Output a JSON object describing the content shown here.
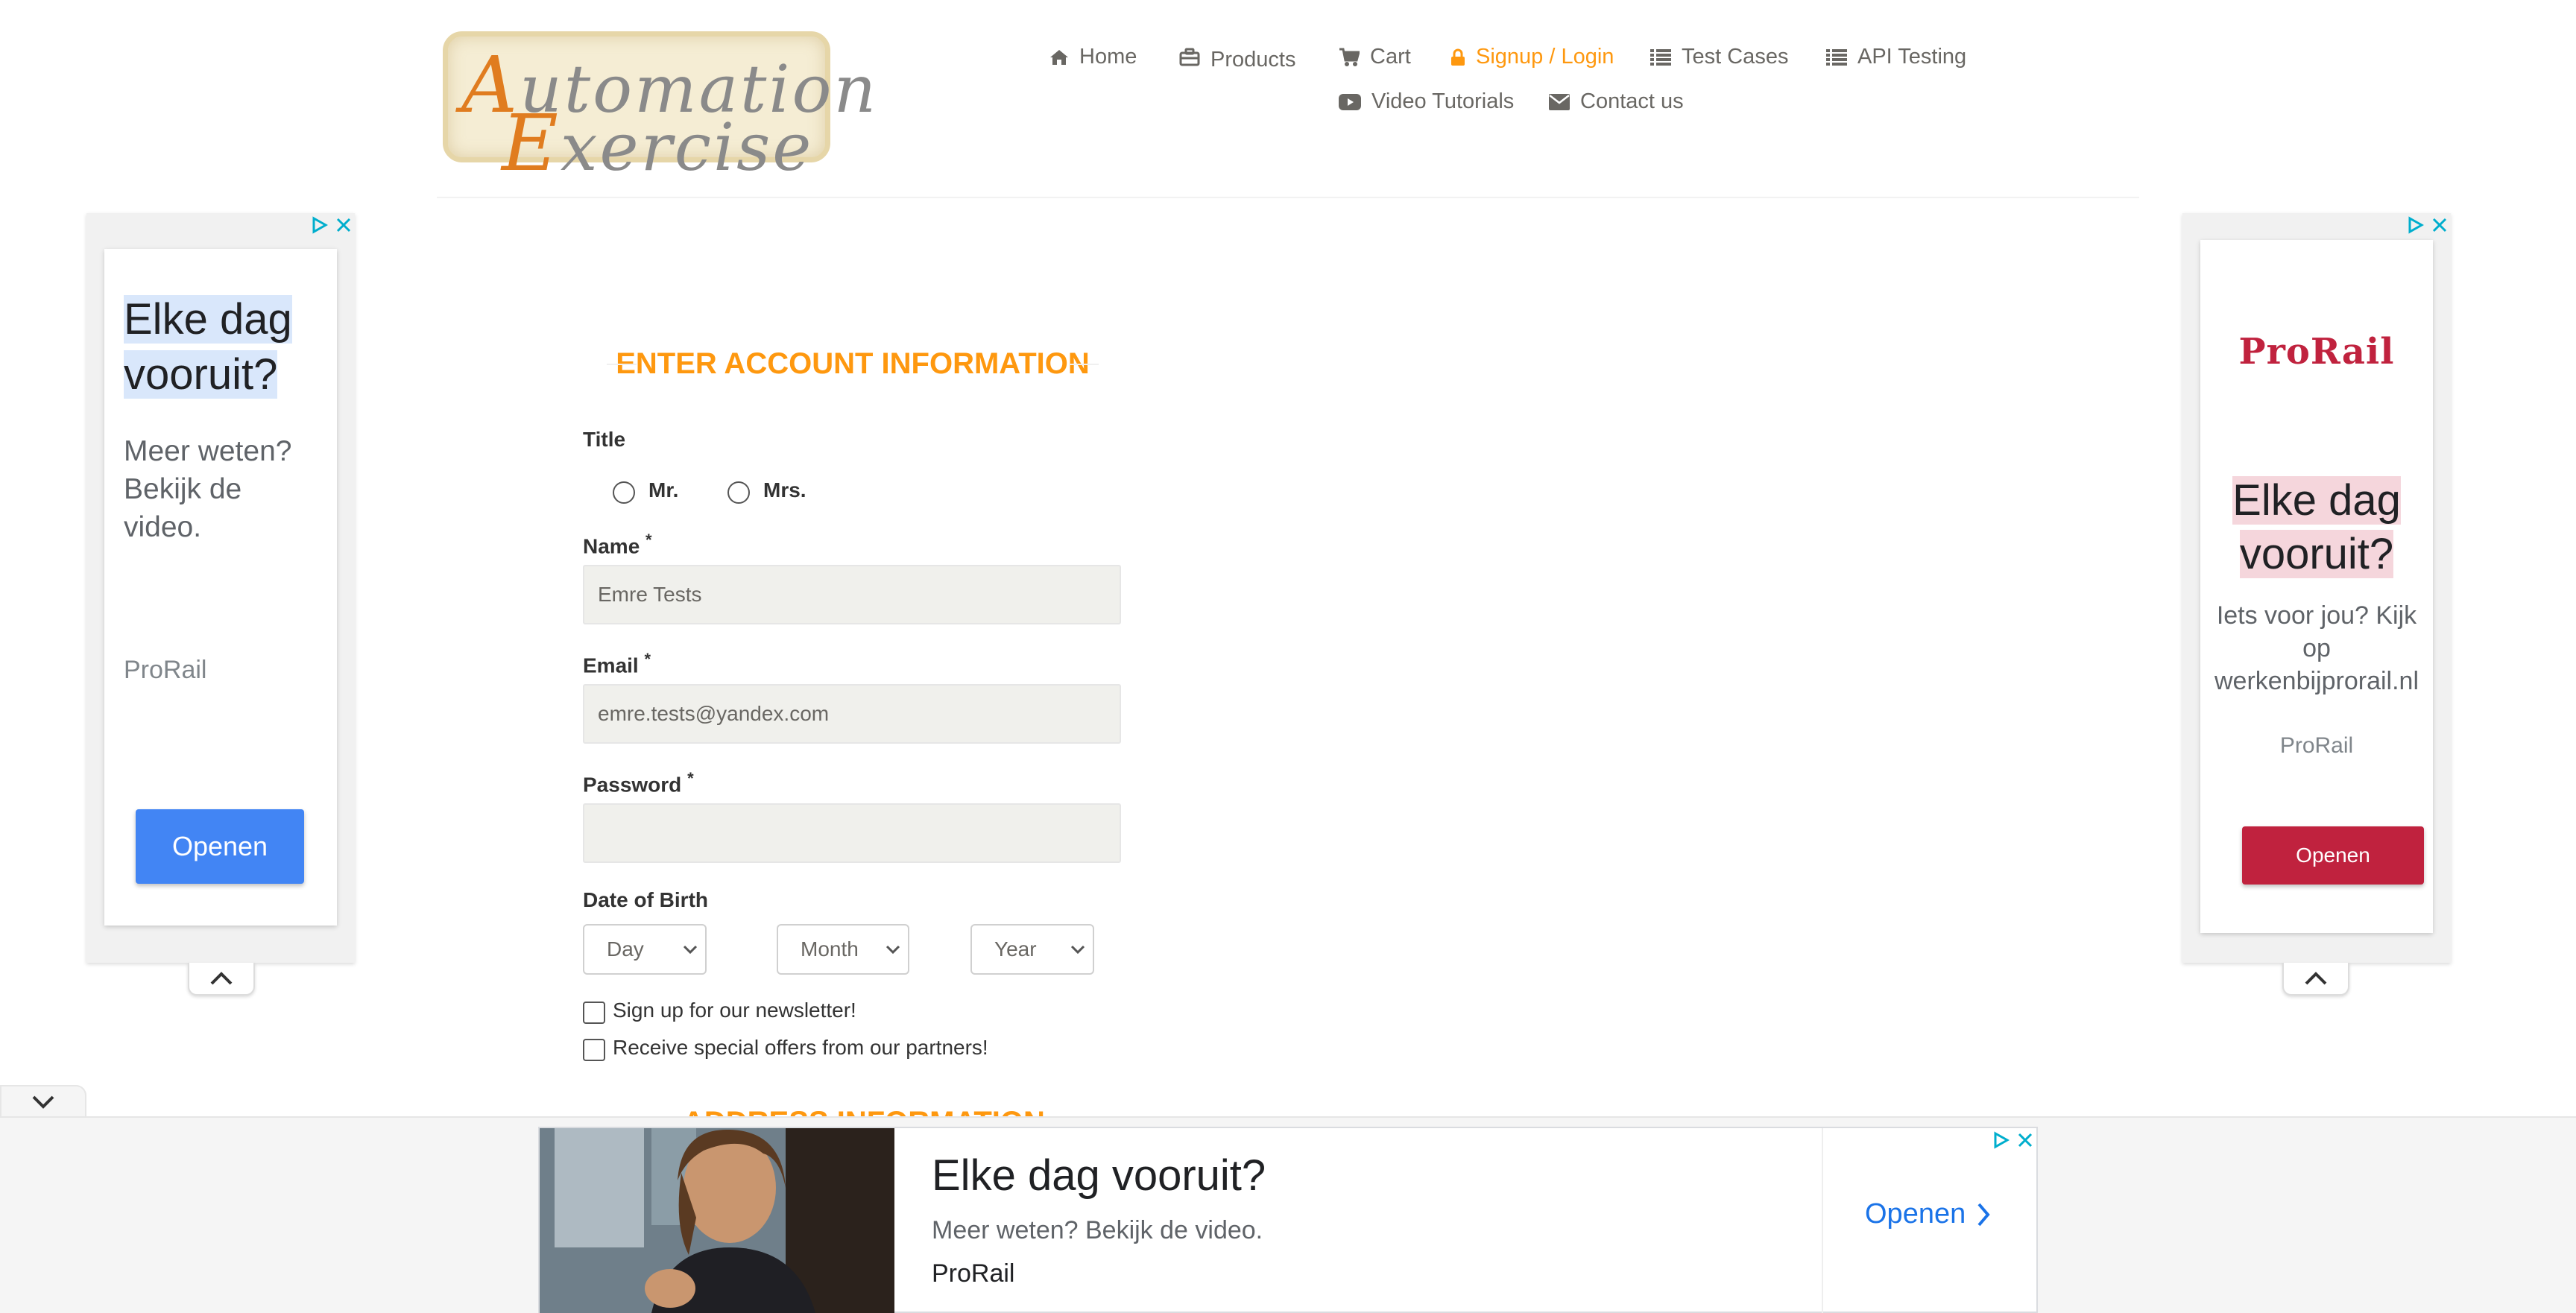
{
  "logo": {
    "line1_cap": "A",
    "line1_rest": "utomation",
    "line2_cap": "E",
    "line2_rest": "xercise"
  },
  "nav": {
    "home": "Home",
    "products": "Products",
    "cart": "Cart",
    "signup_login": "Signup / Login",
    "test_cases": "Test Cases",
    "api_testing": "API Testing",
    "video_tutorials": "Video Tutorials",
    "contact_us": "Contact us"
  },
  "colors": {
    "accent": "#fe980f",
    "ad_blue": "#4285f4",
    "prorail_red": "#c0223e",
    "link_blue": "#1a73e8"
  },
  "left_ad": {
    "headline_line1": "Elke dag",
    "headline_line2": "vooruit?",
    "subtext": "Meer weten? Bekijk de video.",
    "brand": "ProRail",
    "cta": "Openen"
  },
  "right_ad": {
    "logo": "ProRail",
    "headline_line1": "Elke dag",
    "headline_line2": "vooruit?",
    "subtext": "Iets voor jou? Kijk op werkenbijprorail.nl",
    "brand": "ProRail",
    "cta": "Openen"
  },
  "form": {
    "section_title": "ENTER ACCOUNT INFORMATION",
    "title_label": "Title",
    "title_options": [
      "Mr.",
      "Mrs."
    ],
    "name_label": "Name",
    "name_value": "Emre Tests",
    "email_label": "Email",
    "email_value": "emre.tests@yandex.com",
    "password_label": "Password",
    "password_value": "",
    "required_mark": "*",
    "dob_label": "Date of Birth",
    "dob_day": "Day",
    "dob_month": "Month",
    "dob_year": "Year",
    "newsletter_label": "Sign up for our newsletter!",
    "offers_label": "Receive special offers from our partners!",
    "address_section_title": "ADDRESS INFORMATION"
  },
  "bottom_ad": {
    "headline": "Elke dag vooruit?",
    "subtext": "Meer weten? Bekijk de video.",
    "brand": "ProRail",
    "cta": "Openen"
  },
  "icons": [
    "home-icon",
    "briefcase-icon",
    "cart-icon",
    "lock-icon",
    "list-icon",
    "youtube-icon",
    "envelope-icon",
    "adchoices-icon",
    "close-icon",
    "chevron-up-icon",
    "chevron-down-icon",
    "chevron-right-icon"
  ]
}
